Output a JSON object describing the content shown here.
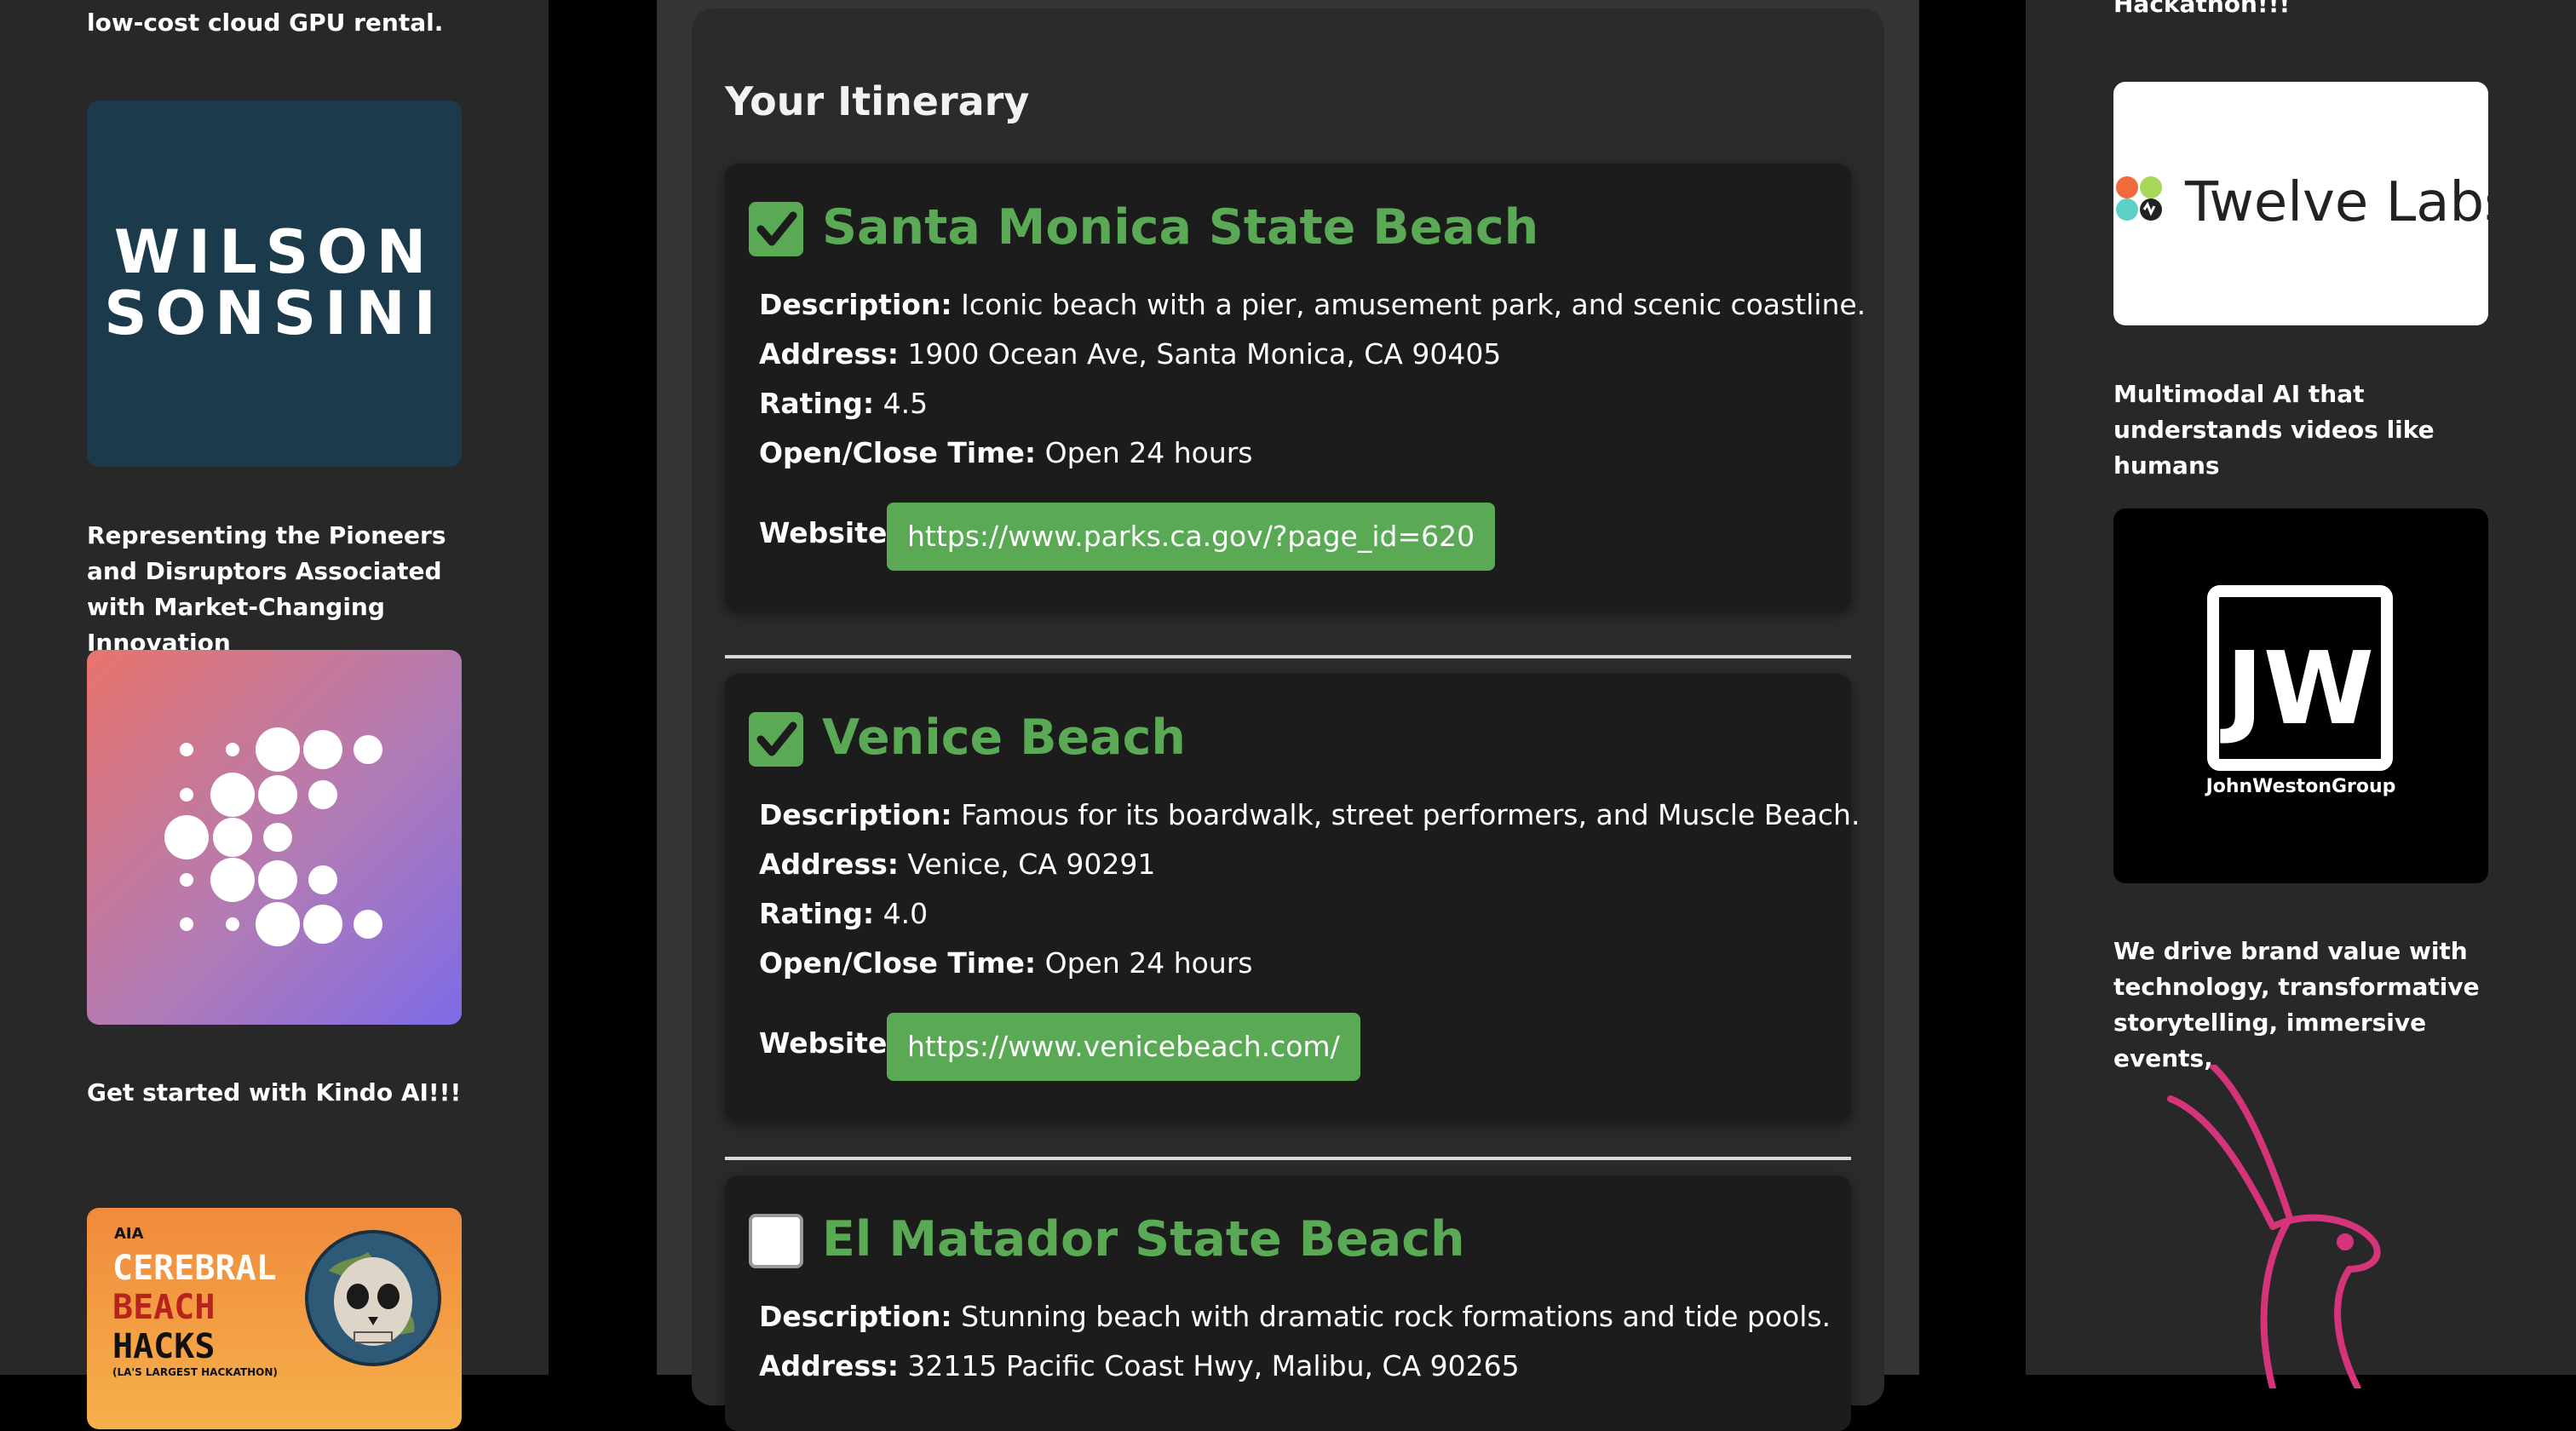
{
  "left_sidebar": {
    "top_caption": "low-cost cloud GPU rental.",
    "wilson_logo": {
      "line1": "WILSON",
      "line2": "SONSINI",
      "bg_color": "#1b3a4b"
    },
    "wilson_caption": "Representing the Pioneers and Disruptors Associated with Market-Changing Innovation",
    "kindo_caption": "Get started with Kindo AI!!!",
    "cerebral_logo": {
      "brand": "AIA",
      "line1": "CEREBRAL",
      "line2": "BEACH",
      "line3": "HACKS",
      "tagline": "(LA'S LARGEST HACKATHON)"
    }
  },
  "right_sidebar": {
    "top_caption": "Hackathon!!!",
    "twelve_labs_logo": "Twelve Labs",
    "twelve_labs_caption": "Multimodal AI that understands videos like humans",
    "jwg_logo": {
      "mark": "JW",
      "name": "JohnWestonGroup"
    },
    "jwg_caption": "We drive brand value with technology, transformative storytelling, immersive events,"
  },
  "itinerary": {
    "title": "Your Itinerary",
    "labels": {
      "description": "Description:",
      "address": "Address:",
      "rating": "Rating:",
      "open_close": "Open/Close Time:",
      "website": "Website:"
    },
    "places": [
      {
        "name": "Santa Monica State Beach",
        "checked": true,
        "description": "Iconic beach with a pier, amusement park, and scenic coastline.",
        "address": "1900 Ocean Ave, Santa Monica, CA 90405",
        "rating": "4.5",
        "open_close": "Open 24 hours",
        "website": "https://www.parks.ca.gov/?page_id=620"
      },
      {
        "name": "Venice Beach",
        "checked": true,
        "description": "Famous for its boardwalk, street performers, and Muscle Beach.",
        "address": "Venice, CA 90291",
        "rating": "4.0",
        "open_close": "Open 24 hours",
        "website": "https://www.venicebeach.com/"
      },
      {
        "name": "El Matador State Beach",
        "checked": false,
        "description": "Stunning beach with dramatic rock formations and tide pools.",
        "address": "32115 Pacific Coast Hwy, Malibu, CA 90265"
      }
    ]
  },
  "colors": {
    "accent_green": "#5aa954",
    "sidebar_bg": "#282828",
    "center_bg": "#343434",
    "card_bg": "#1c1c1c",
    "rabbit_pink": "#d6347a"
  }
}
